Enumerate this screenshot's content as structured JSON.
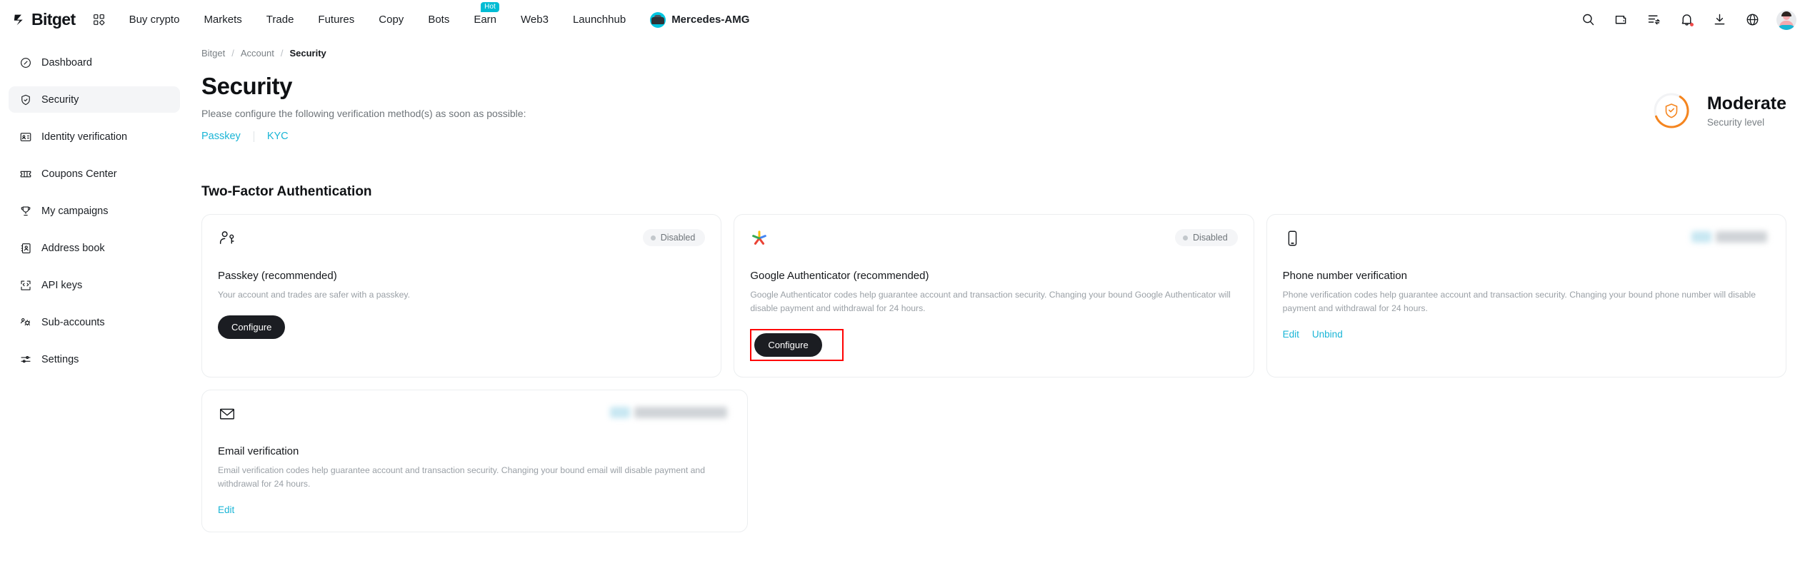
{
  "brand": {
    "name": "Bitget",
    "logo_icon": "bitget-logo-icon",
    "apps_icon": "grid-apps-icon"
  },
  "topnav": {
    "items": [
      {
        "label": "Buy crypto",
        "badge": null,
        "icon": null
      },
      {
        "label": "Markets",
        "badge": null,
        "icon": null
      },
      {
        "label": "Trade",
        "badge": null,
        "icon": null
      },
      {
        "label": "Futures",
        "badge": null,
        "icon": null
      },
      {
        "label": "Copy",
        "badge": null,
        "icon": null
      },
      {
        "label": "Bots",
        "badge": null,
        "icon": null
      },
      {
        "label": "Earn",
        "badge": "Hot",
        "icon": null
      },
      {
        "label": "Web3",
        "badge": null,
        "icon": null
      },
      {
        "label": "Launchhub",
        "badge": null,
        "icon": null
      },
      {
        "label": "Mercedes-AMG",
        "badge": null,
        "icon": "amg-car-icon"
      }
    ],
    "right_icons": [
      "search-icon",
      "wallet-icon",
      "orders-icon",
      "notification-bell-icon",
      "download-icon",
      "language-globe-icon",
      "user-avatar"
    ]
  },
  "sidebar": {
    "items": [
      {
        "label": "Dashboard",
        "icon": "compass-icon",
        "active": false
      },
      {
        "label": "Security",
        "icon": "shield-check-icon",
        "active": true
      },
      {
        "label": "Identity verification",
        "icon": "id-card-icon",
        "active": false
      },
      {
        "label": "Coupons Center",
        "icon": "ticket-icon",
        "active": false
      },
      {
        "label": "My campaigns",
        "icon": "trophy-icon",
        "active": false
      },
      {
        "label": "Address book",
        "icon": "address-book-icon",
        "active": false
      },
      {
        "label": "API keys",
        "icon": "code-brackets-icon",
        "active": false
      },
      {
        "label": "Sub-accounts",
        "icon": "users-gear-icon",
        "active": false
      },
      {
        "label": "Settings",
        "icon": "sliders-icon",
        "active": false
      }
    ]
  },
  "breadcrumb": {
    "root": "Bitget",
    "sep1": "/",
    "parent": "Account",
    "sep2": "/",
    "current": "Security"
  },
  "page": {
    "title": "Security",
    "subtitle": "Please configure the following verification method(s) as soon as possible:",
    "quick_links": [
      {
        "label": "Passkey"
      },
      {
        "label": "KYC"
      }
    ]
  },
  "security_level": {
    "value": "Moderate",
    "caption": "Security level",
    "icon": "shield-check-icon",
    "accent_color": "#f5851f",
    "ring_percent": 60
  },
  "section": {
    "title": "Two-Factor Authentication"
  },
  "cards": [
    {
      "id": "passkey",
      "icon": "passkey-person-icon",
      "status": {
        "type": "badge",
        "label": "Disabled",
        "dot_color": "#c3c8cc"
      },
      "title": "Passkey (recommended)",
      "description": "Your account and trades are safer with a passkey.",
      "primary_button": "Configure",
      "highlighted": false,
      "links": []
    },
    {
      "id": "google-authenticator",
      "icon": "google-authenticator-icon",
      "status": {
        "type": "badge",
        "label": "Disabled",
        "dot_color": "#c3c8cc"
      },
      "title": "Google Authenticator (recommended)",
      "description": "Google Authenticator codes help guarantee account and transaction security. Changing your bound Google Authenticator will disable payment and withdrawal for 24 hours.",
      "primary_button": "Configure",
      "highlighted": true,
      "highlight_color": "#ff0000",
      "links": []
    },
    {
      "id": "phone-number-verification",
      "icon": "phone-icon",
      "status": {
        "type": "redacted",
        "label": ""
      },
      "title": "Phone number verification",
      "description": "Phone verification codes help guarantee account and transaction security. Changing your bound phone number will disable payment and withdrawal for 24 hours.",
      "primary_button": null,
      "highlighted": false,
      "links": [
        {
          "label": "Edit"
        },
        {
          "label": "Unbind"
        }
      ]
    },
    {
      "id": "email-verification",
      "icon": "envelope-icon",
      "status": {
        "type": "redacted-wide",
        "label": ""
      },
      "title": "Email verification",
      "description": "Email verification codes help guarantee account and transaction security. Changing your bound email will disable payment and withdrawal for 24 hours.",
      "primary_button": null,
      "highlighted": false,
      "links": [
        {
          "label": "Edit"
        }
      ]
    }
  ],
  "colors": {
    "accent_link": "#1ab5d6",
    "hot_badge": "#00bcd4",
    "button_dark": "#1b1d22",
    "highlight": "#ff0000"
  }
}
